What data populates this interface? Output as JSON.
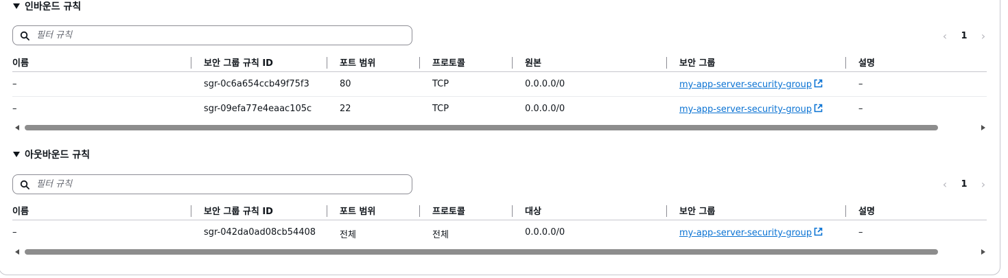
{
  "inbound": {
    "title": "인바운드 규칙",
    "filter_placeholder": "필터 규칙",
    "page": "1",
    "columns": [
      "이름",
      "보안 그룹 규칙 ID",
      "포트 범위",
      "프로토콜",
      "원본",
      "보안 그룹",
      "설명"
    ],
    "rows": [
      {
        "name": "–",
        "rule_id": "sgr-0c6a654ccb49f75f3",
        "port": "80",
        "protocol": "TCP",
        "source": "0.0.0.0/0",
        "group": "my-app-server-security-group",
        "description": "–"
      },
      {
        "name": "–",
        "rule_id": "sgr-09efa77e4eaac105c",
        "port": "22",
        "protocol": "TCP",
        "source": "0.0.0.0/0",
        "group": "my-app-server-security-group",
        "description": "–"
      }
    ]
  },
  "outbound": {
    "title": "아웃바운드 규칙",
    "filter_placeholder": "필터 규칙",
    "page": "1",
    "columns": [
      "이름",
      "보안 그룹 규칙 ID",
      "포트 범위",
      "프로토콜",
      "대상",
      "보안 그룹",
      "설명"
    ],
    "rows": [
      {
        "name": "–",
        "rule_id": "sgr-042da0ad08cb54408",
        "port": "전체",
        "protocol": "전체",
        "source": "0.0.0.0/0",
        "group": "my-app-server-security-group",
        "description": "–"
      }
    ]
  },
  "icons": {
    "caret": "caret-down-icon",
    "search": "search-icon",
    "external": "external-link-icon",
    "prev": "chevron-left-icon",
    "next": "chevron-right-icon"
  },
  "colors": {
    "link": "#0972d3",
    "text": "#0f141a",
    "border": "#c6c6cd",
    "scrollbar": "#8d8d8d"
  }
}
